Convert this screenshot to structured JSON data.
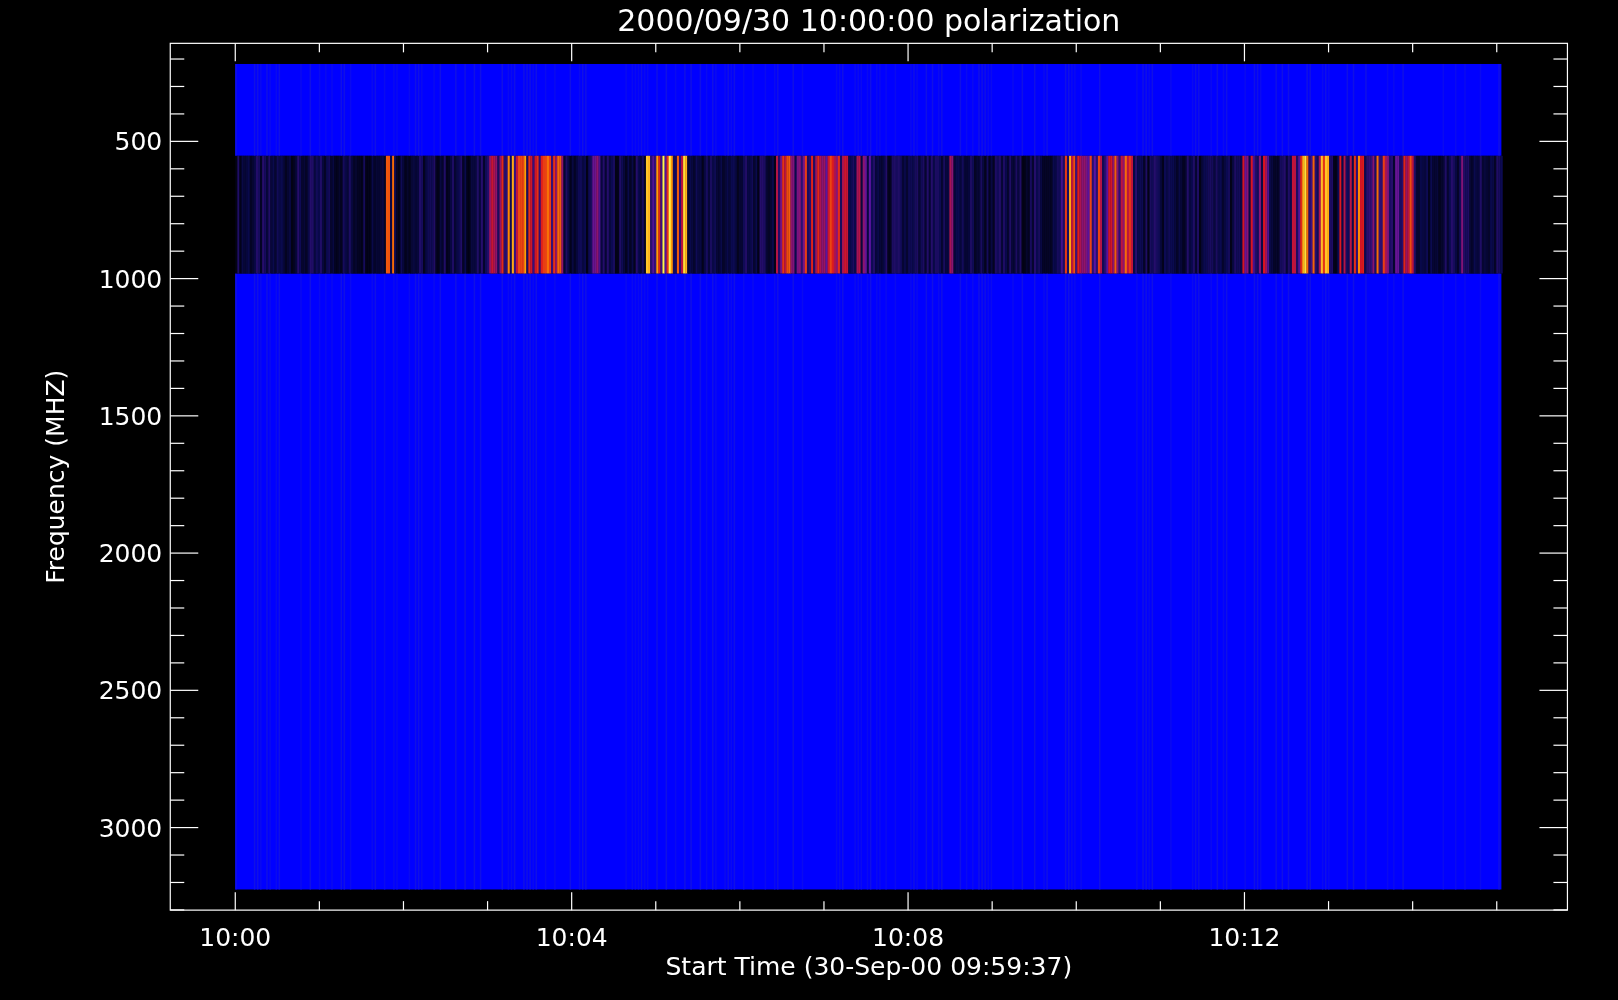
{
  "title": "2000/09/30 10:00:00 polarization",
  "y_axis": {
    "label": "Frequency (MHZ)",
    "tick_labels": [
      "500",
      "1000",
      "1500",
      "2000",
      "2500",
      "3000"
    ]
  },
  "x_axis": {
    "label": "Start Time (30-Sep-00 09:59:37)",
    "tick_labels": [
      "10:00",
      "10:04",
      "10:08",
      "10:12"
    ]
  }
}
